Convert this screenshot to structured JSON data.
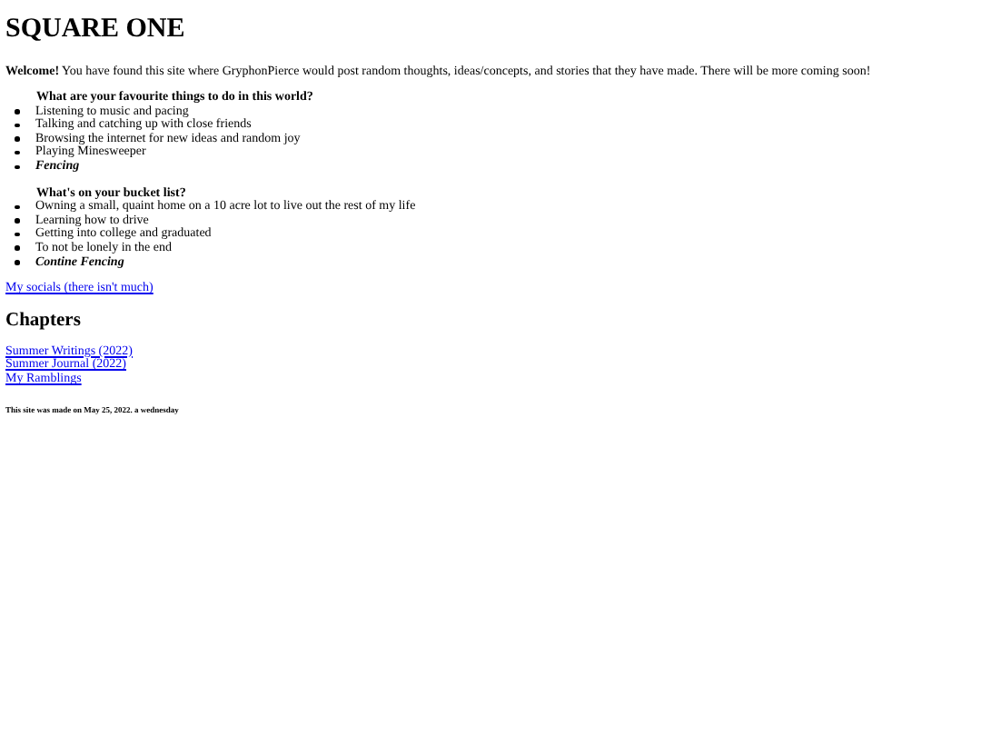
{
  "title": "SQUARE ONE",
  "intro": "**Welcome!** You have found this site where GryphonPierce would post random thoughts, ideas/concepts, and stories that they have made. There will be more coming soon!",
  "lists": [
    {
      "heading": "What are your favourite things to do in this world?",
      "items": [
        {
          "text": "Listening to music and pacing",
          "kind": "plain"
        },
        {
          "text": "Talking and catching up with close friends",
          "kind": "plain"
        },
        {
          "text": "Browsing the internet for new ideas and random joy",
          "kind": "plain"
        },
        {
          "text": "Playing Minesweeper",
          "kind": "plain"
        },
        {
          "text": "Fencing",
          "kind": "emphasis"
        }
      ]
    },
    {
      "heading": "What's on your bucket list?",
      "items": [
        {
          "text": "Owning a small, quaint home on a 10 acre lot to live out the rest of my life",
          "kind": "plain"
        },
        {
          "text": "Learning how to drive",
          "kind": "plain"
        },
        {
          "text": "Getting into college and graduated",
          "kind": "plain"
        },
        {
          "text": "To not be lonely in the end",
          "kind": "plain"
        },
        {
          "text": "Contine Fencing",
          "kind": "emphasis"
        }
      ]
    }
  ],
  "socials_link": "My socials (there isn't much)",
  "chapters": {
    "heading": "Chapters",
    "links": [
      "Summer Writings (2022)",
      "Summer Journal (2022)",
      "My Ramblings"
    ]
  },
  "footer": "This site was made on May 25, 2022. a wednesday"
}
